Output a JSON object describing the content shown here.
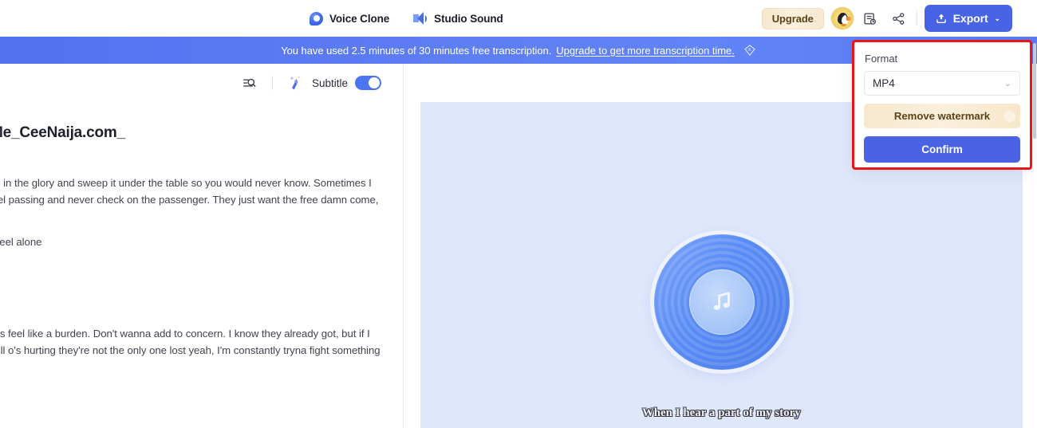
{
  "topbar": {
    "tools": [
      {
        "label": "Voice Clone",
        "icon": "voice-clone-icon"
      },
      {
        "label": "Studio Sound",
        "icon": "studio-sound-icon"
      }
    ],
    "upgrade_label": "Upgrade",
    "avatar_alt": "puffin-avatar",
    "history_icon": "history-document-icon",
    "share_icon": "share-icon",
    "export_label": "Export",
    "export_chevron": "⌄"
  },
  "banner": {
    "message": "You have used 2.5 minutes of 30 minutes free transcription.",
    "link": "Upgrade to get more transcription time.",
    "badge_icon": "diamond-k-icon",
    "bg_color": "#5d7cf3"
  },
  "left_toolbar": {
    "search_icon": "search-list-icon",
    "wand_icon": "magic-wand-icon",
    "subtitle_label": "Subtitle",
    "subtitle_enabled": true
  },
  "transcript": {
    "title": "Me_CeeNaija.com_",
    "paragraphs": [
      "de in the glory and sweep it under the table so you would never know. Sometimes I feel passing and never check on the passenger. They just want the free damn come,",
      "'t feel alone",
      "ays feel like a burden. Don't wanna add to concern. I know they already got, but if I pull o's hurting they're not the only one lost yeah, I'm constantly tryna fight something"
    ]
  },
  "video": {
    "poster_icon": "music-note-disc-icon",
    "caption": "When I hear a part of my story",
    "bg_color": "#dfe7fb"
  },
  "format_panel": {
    "heading": "Format",
    "selected_format": "MP4",
    "format_options": [
      "MP4"
    ],
    "dropdown_chevron": "⌄",
    "remove_watermark_label": "Remove watermark",
    "remove_watermark_badge": "●",
    "confirm_label": "Confirm",
    "highlight_color": "#f41414",
    "confirm_color": "#4a63e5"
  }
}
